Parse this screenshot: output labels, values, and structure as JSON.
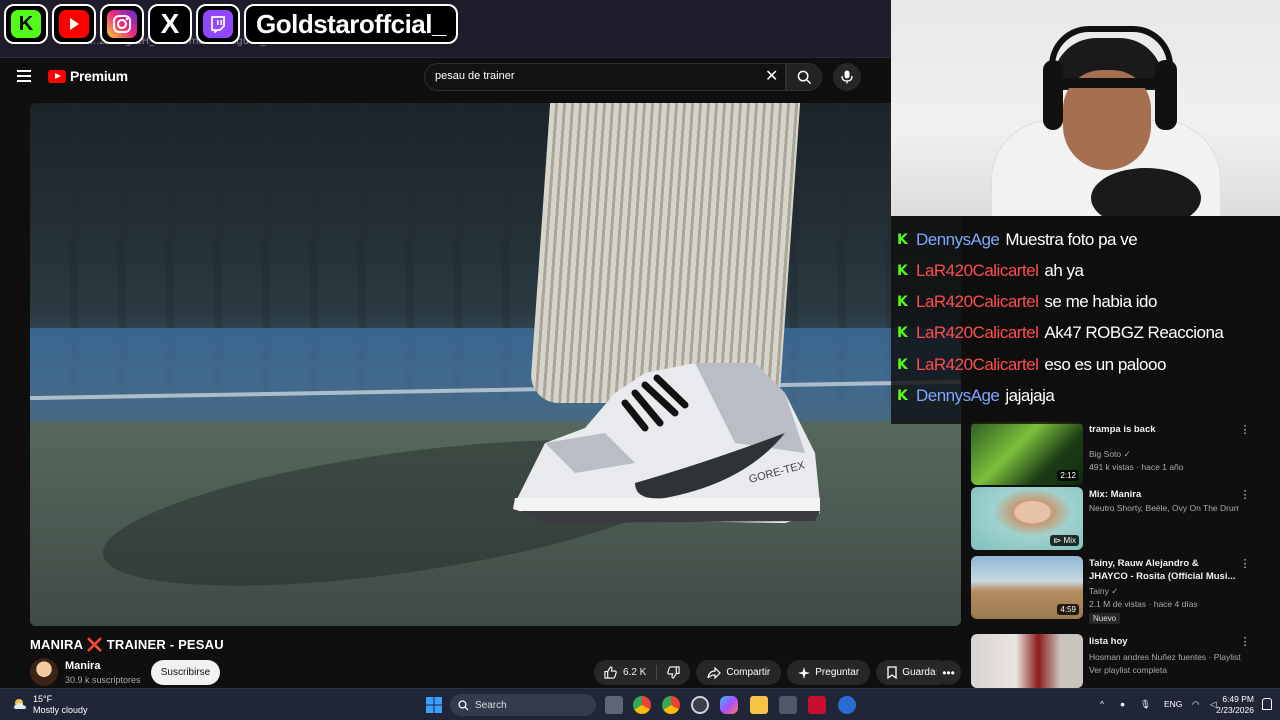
{
  "browser": {
    "address_fragment": "...zAwLgutH_RDF0OmbazAwLgutH_radio=..."
  },
  "overlay": {
    "handle": "Goldstaroffcial_",
    "socials": [
      "kick-icon",
      "youtube-icon",
      "instagram-icon",
      "x-icon",
      "twitch-icon"
    ]
  },
  "header": {
    "logo": "Premium",
    "search_value": "pesau de trainer"
  },
  "video": {
    "title_part1": "MANIRA",
    "title_sep": "❌",
    "title_part2": "TRAINER - PESAU",
    "channel": "Manira",
    "subscribers": "30.9 k suscriptores",
    "subscribe_label": "Suscribirse",
    "likes": "6.2 K",
    "share_label": "Compartir",
    "ask_label": "Preguntar",
    "save_label": "Guardar"
  },
  "chat": [
    {
      "user": "DennysAge",
      "message": "Muestra foto pa ve",
      "color": "#7ea8ff"
    },
    {
      "user": "LaR420Calicartel",
      "message": "ah ya",
      "color": "#ff4d4d"
    },
    {
      "user": "LaR420Calicartel",
      "message": "se me habia ido",
      "color": "#ff4d4d"
    },
    {
      "user": "LaR420Calicartel",
      "message": "Ak47 ROBGZ Reacciona",
      "color": "#ff4d4d"
    },
    {
      "user": "LaR420Calicartel",
      "message": "eso es un palooo",
      "color": "#ff4d4d"
    },
    {
      "user": "DennysAge",
      "message": "jajajaja",
      "color": "#7ea8ff"
    }
  ],
  "sidebar": {
    "recs": [
      {
        "title": "trampa is back",
        "channel": "Big Soto",
        "stats": "491 k vistas · hace 1 año",
        "duration": "2:12",
        "verified": true
      },
      {
        "title": "Mix: Manira",
        "channel": "Neutro Shorty, Beéle, Ovy On The Drums ...",
        "stats": "",
        "duration": "Mix"
      },
      {
        "title": "Tainy, Rauw Alejandro & JHAYCO - Rosita (Official Musi...",
        "channel": "Tainy",
        "stats": "2.1 M de vistas · hace 4 días",
        "duration": "4:59",
        "badge": "Nuevo",
        "verified": true
      },
      {
        "title": "lista hoy",
        "channel": "Hosman andres Nuñez fuentes · Playlist",
        "stats": "Ver playlist completa",
        "duration": ""
      }
    ]
  },
  "taskbar": {
    "temp": "15°F",
    "weather": "Mostly cloudy",
    "search_label": "Search",
    "lang": "ENG",
    "time": "6:49 PM",
    "date": "2/23/2026"
  }
}
